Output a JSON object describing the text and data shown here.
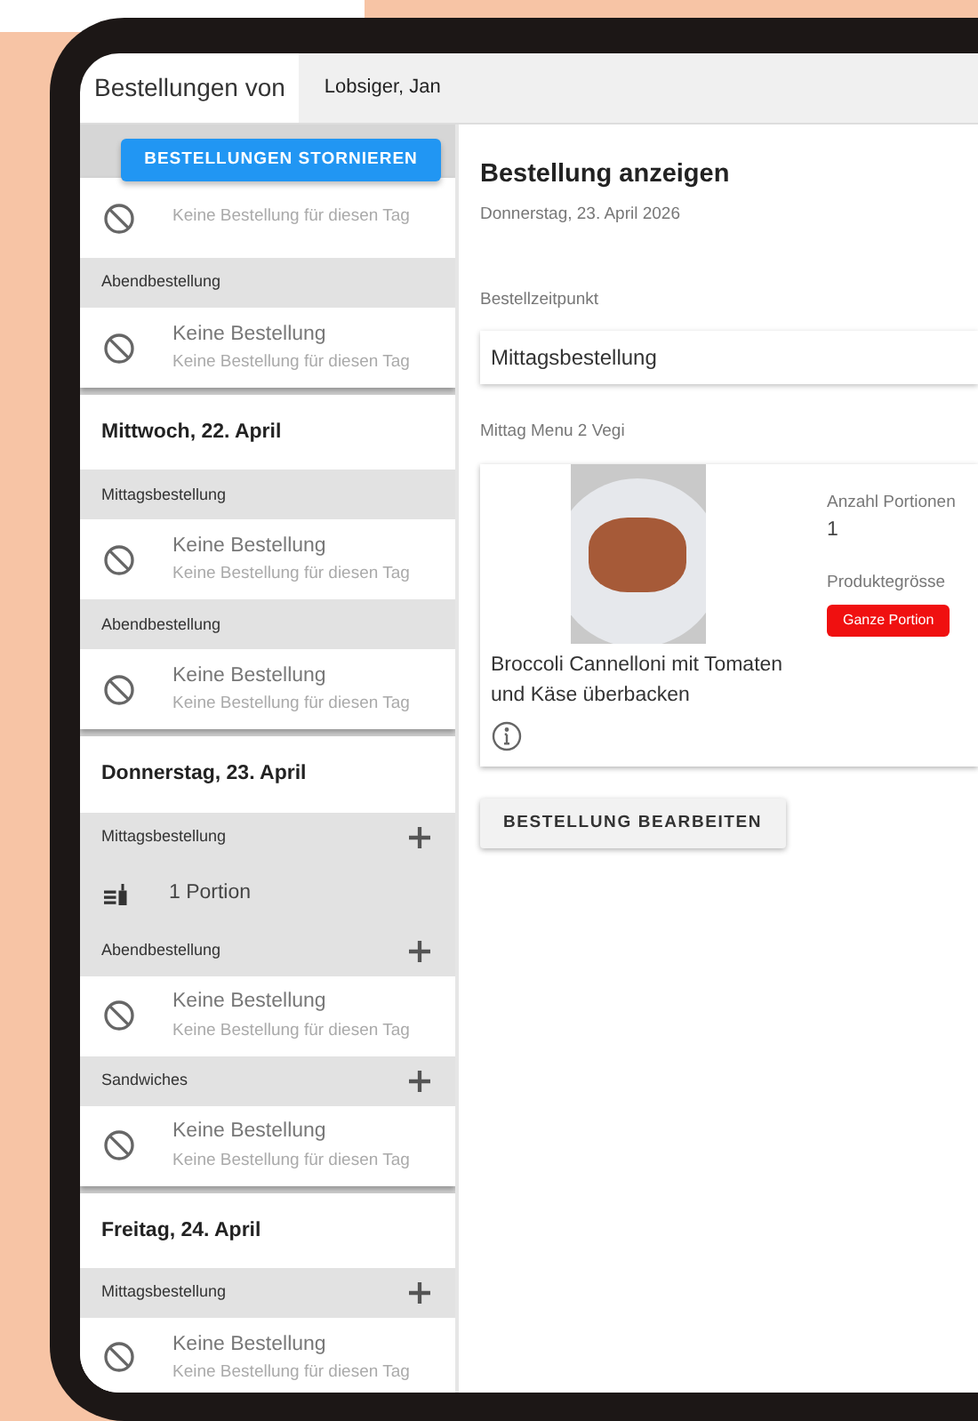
{
  "header": {
    "label": "Bestellungen von",
    "user": "Lobsiger, Jan"
  },
  "cancel_button": "BESTELLUNGEN STORNIEREN",
  "days": [
    {
      "sections": [
        {
          "entries": [
            {
              "kind": "none",
              "subtitle": "Keine Bestellung für diesen Tag"
            }
          ]
        },
        {
          "title": "Abendbestellung",
          "addable": false,
          "entries": [
            {
              "kind": "none",
              "title": "Keine Bestellung",
              "subtitle": "Keine Bestellung für diesen Tag"
            }
          ]
        }
      ]
    },
    {
      "date": "Mittwoch, 22. April",
      "sections": [
        {
          "title": "Mittagsbestellung",
          "addable": false,
          "entries": [
            {
              "kind": "none",
              "title": "Keine Bestellung",
              "subtitle": "Keine Bestellung für diesen Tag"
            }
          ]
        },
        {
          "title": "Abendbestellung",
          "addable": false,
          "entries": [
            {
              "kind": "none",
              "title": "Keine Bestellung",
              "subtitle": "Keine Bestellung für diesen Tag"
            }
          ]
        }
      ]
    },
    {
      "date": "Donnerstag, 23. April",
      "sections": [
        {
          "title": "Mittagsbestellung",
          "addable": true,
          "entries": [
            {
              "kind": "portion",
              "title": "1 Portion"
            }
          ]
        },
        {
          "title": "Abendbestellung",
          "addable": true,
          "entries": [
            {
              "kind": "none",
              "title": "Keine Bestellung",
              "subtitle": "Keine Bestellung für diesen Tag"
            }
          ]
        },
        {
          "title": "Sandwiches",
          "addable": true,
          "entries": [
            {
              "kind": "none",
              "title": "Keine Bestellung",
              "subtitle": "Keine Bestellung für diesen Tag"
            }
          ]
        }
      ]
    },
    {
      "date": "Freitag, 24. April",
      "sections": [
        {
          "title": "Mittagsbestellung",
          "addable": true,
          "entries": [
            {
              "kind": "none",
              "title": "Keine Bestellung",
              "subtitle": "Keine Bestellung für diesen Tag"
            }
          ]
        }
      ]
    }
  ],
  "detail": {
    "title": "Bestellung anzeigen",
    "date": "Donnerstag, 23. April 2026",
    "time_label": "Bestellzeitpunkt",
    "time_value": "Mittagsbestellung",
    "menu_label": "Mittag Menu 2 Vegi",
    "dish": {
      "name": "Broccoli Cannelloni mit Tomaten und Käse überbacken",
      "portions_label": "Anzahl Portionen",
      "portions": "1",
      "size_label": "Produktegrösse",
      "size": "Ganze Portion"
    },
    "edit_button": "BESTELLUNG BEARBEITEN"
  }
}
